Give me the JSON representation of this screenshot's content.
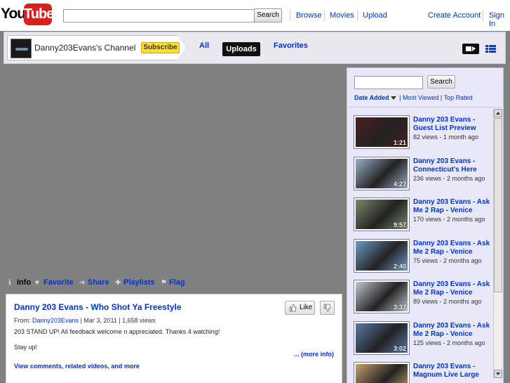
{
  "topbar": {
    "logo_you": "You",
    "logo_tube": "Tube",
    "search_value": "",
    "search_button": "Search",
    "nav": [
      "Browse",
      "Movies",
      "Upload"
    ],
    "create_account": "Create Account",
    "sign_in": "Sign In"
  },
  "channel": {
    "name": "Danny203Evans's Channel",
    "subscribe": "Subscribe",
    "tabs": {
      "all": "All",
      "uploads": "Uploads",
      "favorites": "Favorites"
    }
  },
  "actions": {
    "info": "Info",
    "favorite": "Favorite",
    "share": "Share",
    "playlists": "Playlists",
    "flag": "Flag"
  },
  "video": {
    "title": "Danny 203 Evans - Who Shot Ya Freestyle",
    "like": "Like",
    "from_label": "From:",
    "from_user": "Danny203Evans",
    "date": "Mar 3, 2011",
    "views": "1,658 views",
    "description_1": "203 STAND UP! All feedback welcome n appreciated. Thanks 4 watching!",
    "description_2": "Stay up!",
    "more_info": "... (more info)",
    "view_comments": "View comments, related videos, and more"
  },
  "side": {
    "search_value": "",
    "search_button": "Search",
    "sort": {
      "date_added": "Date Added",
      "most_viewed": "Most Viewed",
      "top_rated": "Top Rated"
    },
    "videos": [
      {
        "title": "Danny 203 Evans - Guest List Preview",
        "meta": "82 views - 1 month ago",
        "duration": "1:21",
        "color": "#4a2020"
      },
      {
        "title": "Danny 203 Evans - Connecticut's Here",
        "meta": "236 views - 2 months ago",
        "duration": "4:27",
        "color": "#9aaec8"
      },
      {
        "title": "Danny 203 Evans - Ask Me 2 Rap - Venice",
        "meta": "170 views - 2 months ago",
        "duration": "9:57",
        "color": "#7a8a6a"
      },
      {
        "title": "Danny 203 Evans - Ask Me 2 Rap - Venice",
        "meta": "75 views - 2 months ago",
        "duration": "2:40",
        "color": "#6f9ac8"
      },
      {
        "title": "Danny 203 Evans - Ask Me 2 Rap - Venice",
        "meta": "89 views - 2 months ago",
        "duration": "3:37",
        "color": "#c0c8d0"
      },
      {
        "title": "Danny 203 Evans - Ask Me 2 Rap - Venice",
        "meta": "125 views - 2 months ago",
        "duration": "3:02",
        "color": "#5a78a8"
      },
      {
        "title": "Danny 203 Evans - Magnum Live Large",
        "meta": "",
        "duration": "",
        "color": "#c8a070"
      }
    ]
  }
}
